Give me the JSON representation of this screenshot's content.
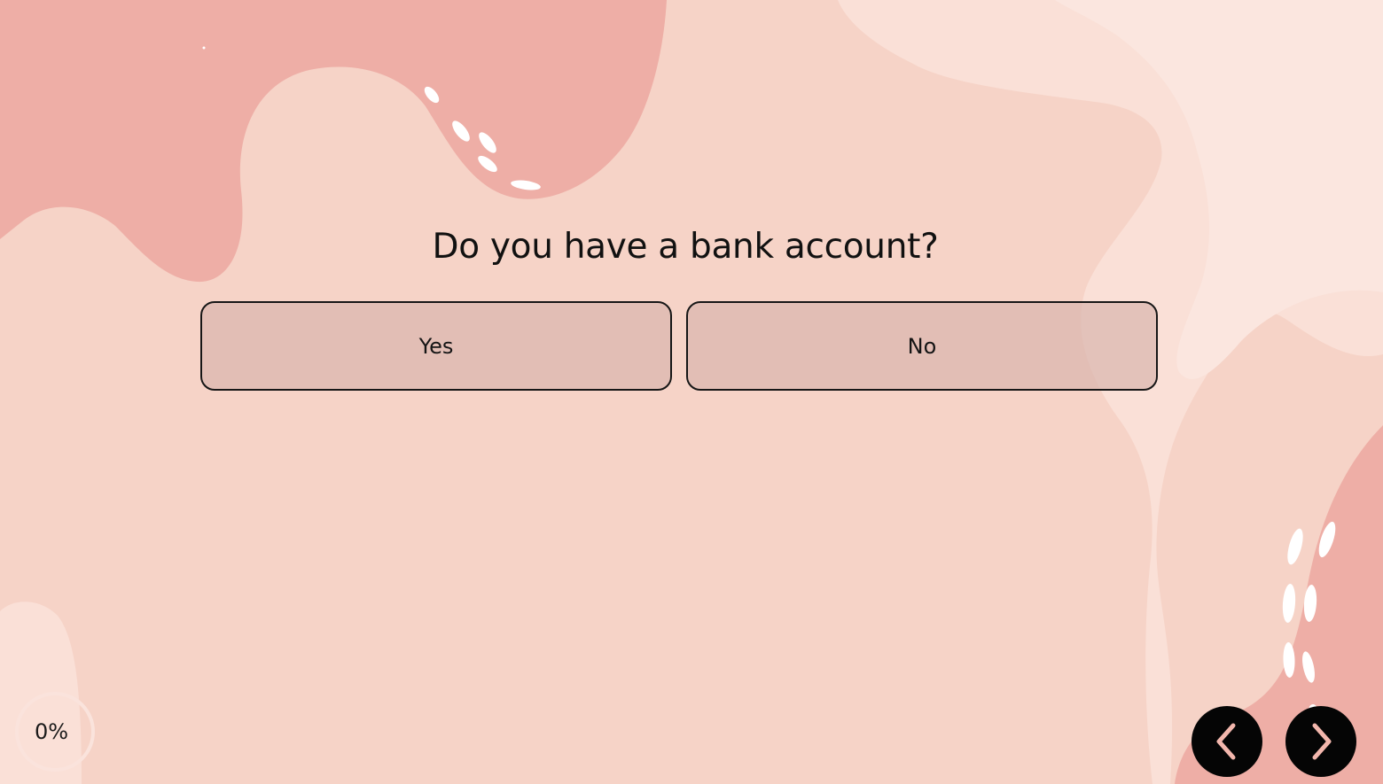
{
  "survey": {
    "question": "Do you have a bank account?",
    "options": [
      "Yes",
      "No"
    ]
  },
  "progress": {
    "label": "0%",
    "value": 0
  },
  "navigation": {
    "previous_icon": "chevron-left-icon",
    "next_icon": "chevron-right-icon"
  },
  "theme": {
    "background": "#f6d3c7",
    "blob_dark": "#eeaea6",
    "blob_light": "#fae2da",
    "chevron": "#f3b7ad",
    "button_fill": "#050505"
  }
}
